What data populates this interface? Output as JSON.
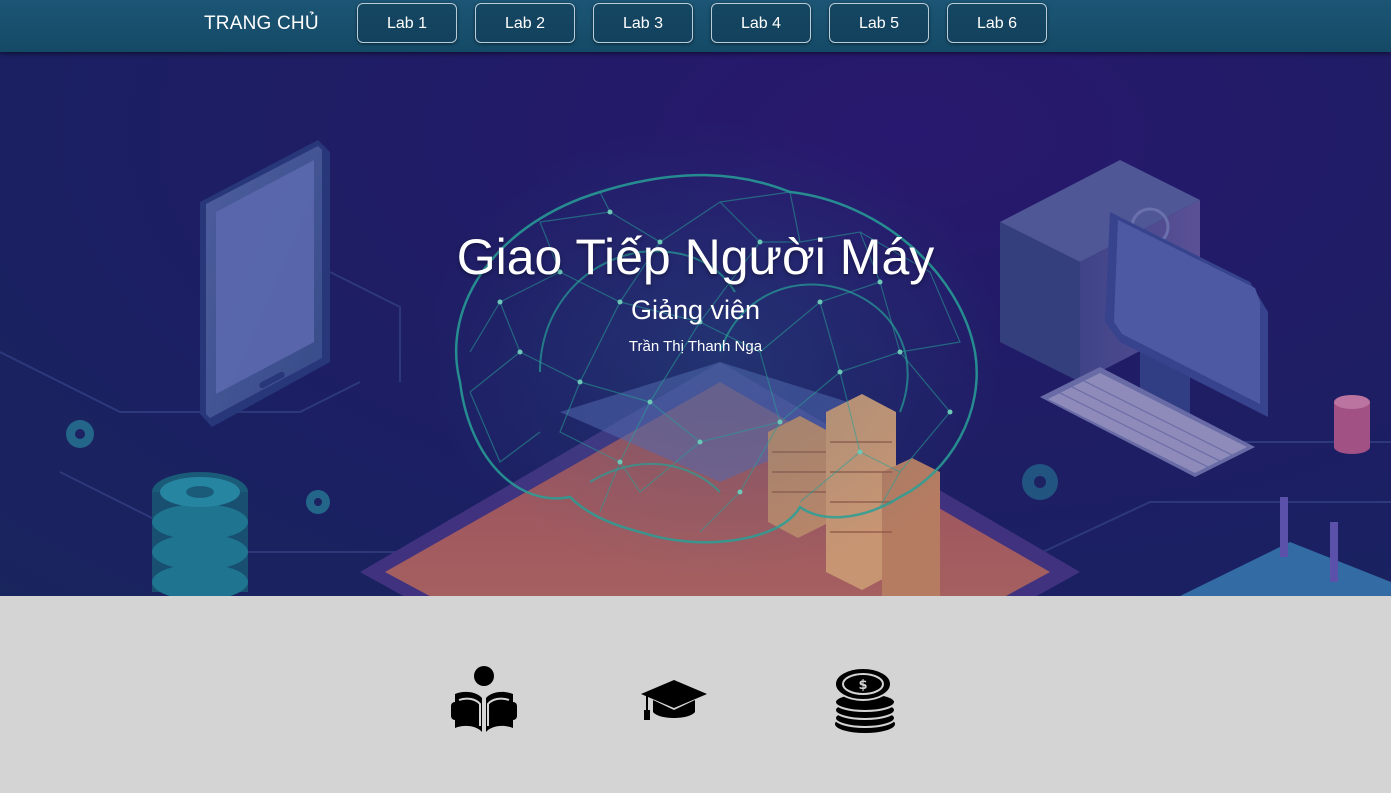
{
  "nav": {
    "brand": "TRANG CHỦ",
    "labs": [
      {
        "label": "Lab 1"
      },
      {
        "label": "Lab 2"
      },
      {
        "label": "Lab 3"
      },
      {
        "label": "Lab 4"
      },
      {
        "label": "Lab 5"
      },
      {
        "label": "Lab 6"
      }
    ]
  },
  "hero": {
    "title": "Giao Tiếp Người Máy",
    "subtitle": "Giảng viên",
    "lecturer": "Trần Thị Thanh Nga"
  },
  "features": [
    {
      "icon": "reader-book-icon"
    },
    {
      "icon": "graduation-cap-icon"
    },
    {
      "icon": "coins-stack-icon"
    }
  ],
  "colors": {
    "navbar": "#1a5070",
    "hero_bg": "#241f6e",
    "brain_mesh": "#2bbfa8",
    "section_bg": "#d4d4d4"
  }
}
